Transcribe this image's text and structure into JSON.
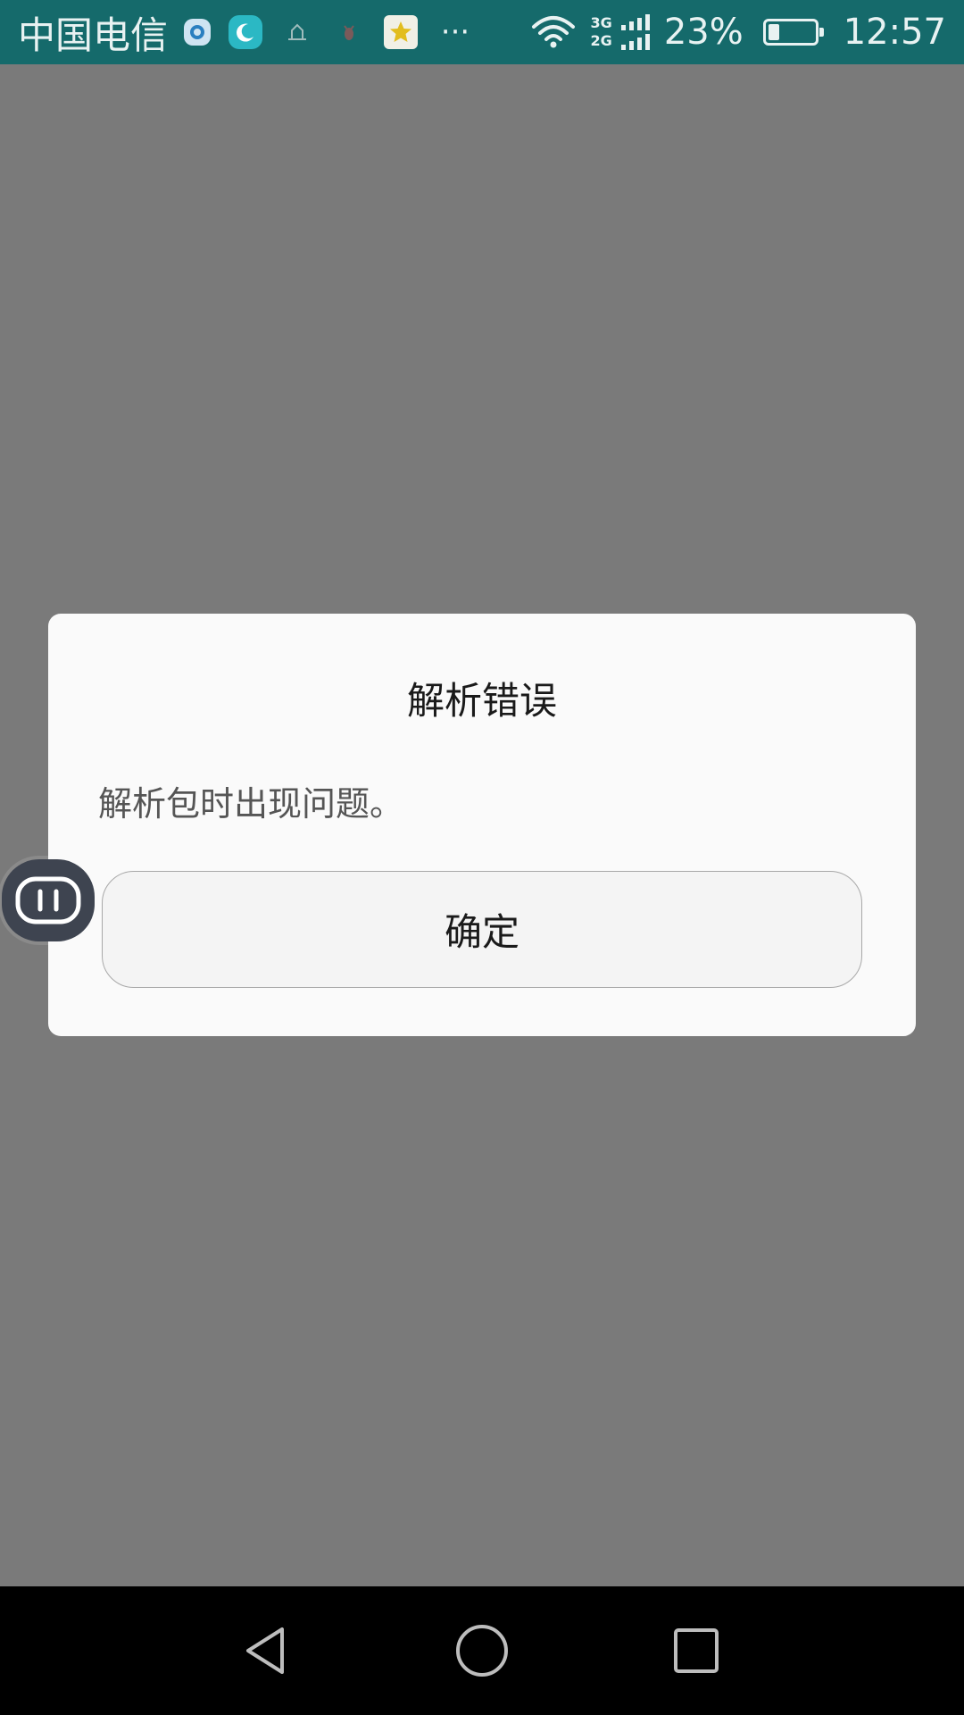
{
  "status_bar": {
    "carrier": "中国电信",
    "notification_icons": [
      "browser-icon",
      "moon-app-icon",
      "weather-icon",
      "pest-icon",
      "star-app-icon"
    ],
    "more": "···",
    "network_types": [
      "3G",
      "2G"
    ],
    "battery_percent": "23%",
    "battery_level": 0.23,
    "time": "12:57",
    "background_color": "#156a6b"
  },
  "dialog": {
    "title": "解析错误",
    "message": "解析包时出现问题。",
    "confirm_label": "确定"
  },
  "nav_bar": {
    "buttons": [
      "back",
      "home",
      "recent-apps"
    ]
  },
  "colors": {
    "scrim": "#7a7a7a",
    "dialog_bg": "#fafafa",
    "nav_bg": "#000000"
  }
}
